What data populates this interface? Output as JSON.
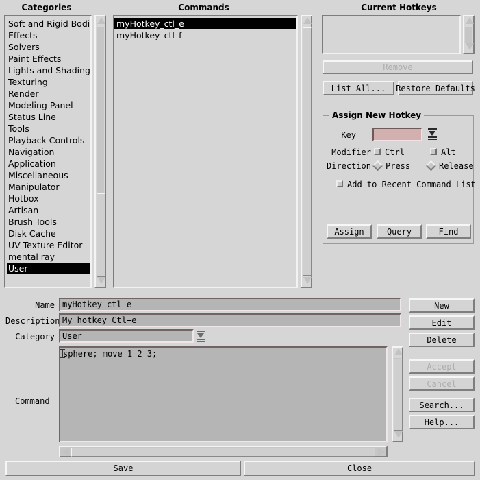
{
  "panels": {
    "categories_title": "Categories",
    "commands_title": "Commands",
    "hotkeys_title": "Current Hotkeys"
  },
  "categories": {
    "items": [
      "Soft and Rigid Bodies",
      "Effects",
      "Solvers",
      "Paint Effects",
      "Lights and Shading",
      "Texturing",
      "Render",
      "Modeling Panel",
      "Status Line",
      "Tools",
      "Playback Controls",
      "Navigation",
      "Application",
      "Miscellaneous",
      "Manipulator",
      "Hotbox",
      "Artisan",
      "Brush Tools",
      "Disk Cache",
      "UV Texture Editor",
      "mental ray",
      "User"
    ],
    "selected_index": 21
  },
  "commands": {
    "items": [
      "myHotkey_ctl_e",
      "myHotkey_ctl_f"
    ],
    "selected_index": 0
  },
  "current_hotkeys": {
    "items": []
  },
  "hotkey_buttons": {
    "remove": "Remove",
    "list_all": "List All...",
    "restore_defaults": "Restore Defaults"
  },
  "assign_group": {
    "title": "Assign New Hotkey",
    "key_label": "Key",
    "key_value": "",
    "modifier_label": "Modifier",
    "ctrl_label": "Ctrl",
    "ctrl_checked": false,
    "alt_label": "Alt",
    "alt_checked": false,
    "direction_label": "Direction",
    "press_label": "Press",
    "release_label": "Release",
    "direction_selected": "Press",
    "recent_label": "Add to Recent Command List",
    "recent_checked": false,
    "assign": "Assign",
    "query": "Query",
    "find": "Find"
  },
  "form": {
    "name_label": "Name",
    "name_value": "myHotkey_ctl_e",
    "description_label": "Description",
    "description_value": "My hotkey Ctl+e",
    "category_label": "Category",
    "category_value": "User",
    "command_label": "Command",
    "command_value": "sphere; move 1 2 3;"
  },
  "side_buttons": {
    "new": "New",
    "edit": "Edit",
    "delete": "Delete",
    "accept": "Accept",
    "cancel": "Cancel",
    "search": "Search...",
    "help": "Help..."
  },
  "bottom_buttons": {
    "save": "Save",
    "close": "Close"
  },
  "colors": {
    "background": "#d6d6d6",
    "key_field": "#d3b0b0",
    "selection": "#000000",
    "field": "#b5b5b5"
  }
}
